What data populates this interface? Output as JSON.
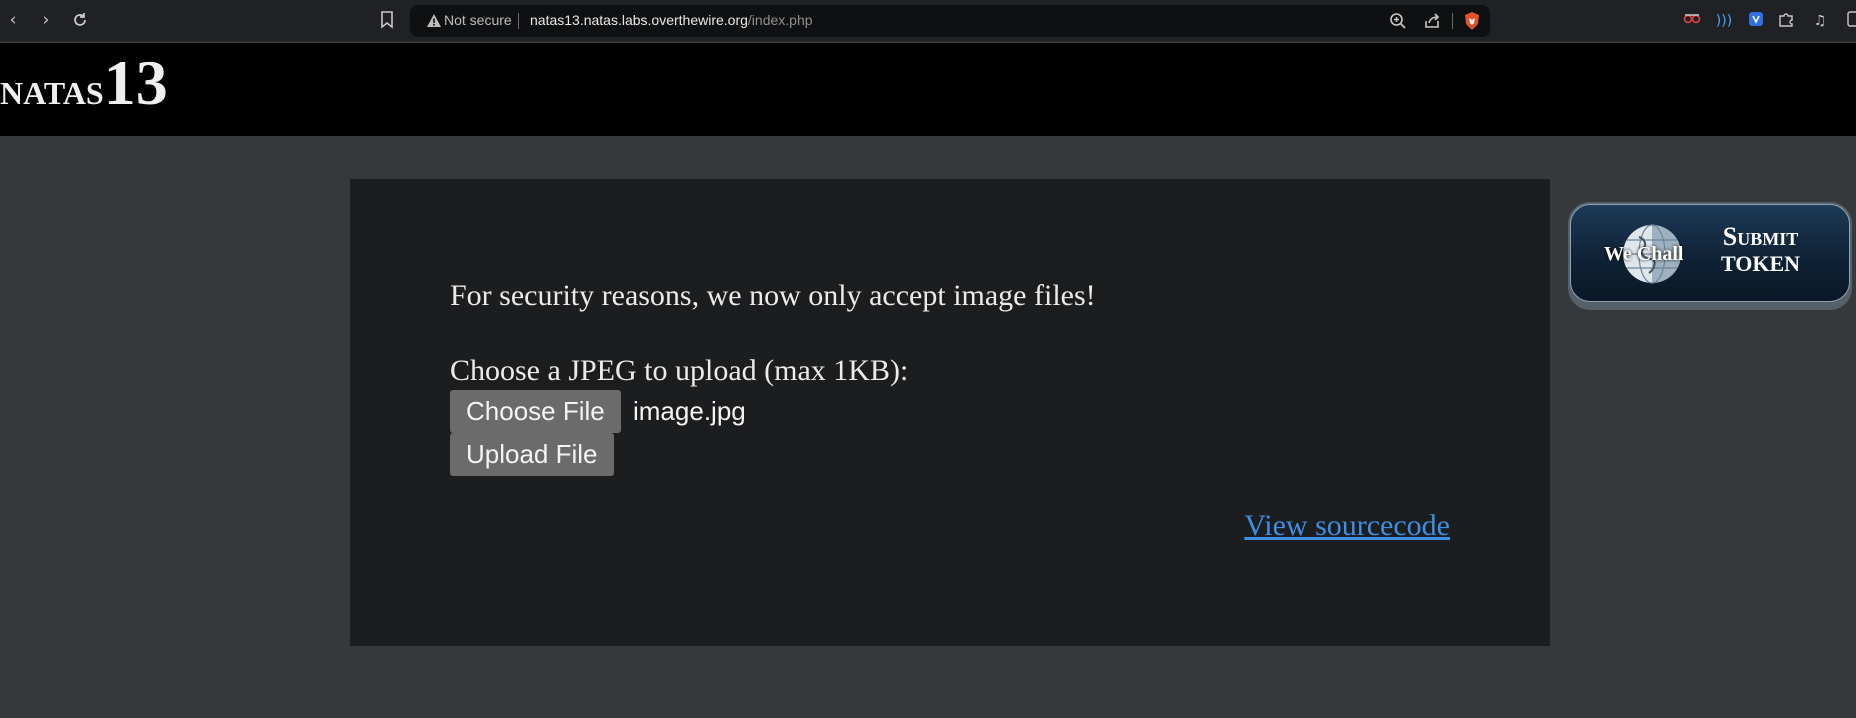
{
  "browser": {
    "security_label": "Not secure",
    "url_host": "natas13.natas.labs.overthewire.org",
    "url_path": "/index.php"
  },
  "header": {
    "logo_name": "natas",
    "logo_number": "13"
  },
  "main": {
    "message": "For security reasons, we now only accept image files!",
    "upload_prompt": "Choose a JPEG to upload (max 1KB):",
    "choose_file_label": "Choose File",
    "selected_file": "image.jpg",
    "upload_label": "Upload File",
    "source_link": "View sourcecode"
  },
  "badge": {
    "wechall_label": "We Chall",
    "submit_label": "Submit",
    "token_label": "TOKEN"
  },
  "colors": {
    "page_bg": "#35393b",
    "content_bg": "#1c1d1f",
    "header_bg": "#000000",
    "button_bg": "#6b6b6b",
    "link": "#3d8fe6"
  },
  "icons": [
    "back-icon",
    "forward-icon",
    "reload-icon",
    "bookmark-icon",
    "warning-icon",
    "zoom-icon",
    "share-icon",
    "brave-shield-icon",
    "extension-icons",
    "puzzle-icon",
    "media-icon",
    "sidebar-icon",
    "globe-icon"
  ]
}
